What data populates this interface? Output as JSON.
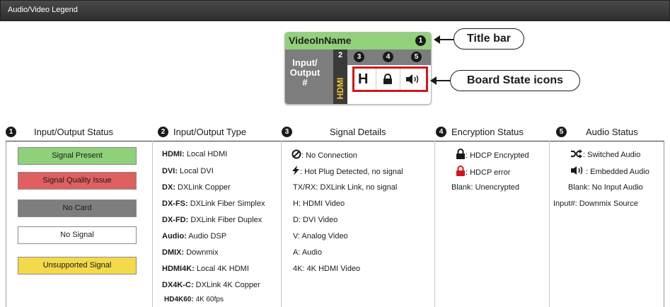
{
  "window": {
    "title": "Audio/Video Legend"
  },
  "board": {
    "name": "VideoInName",
    "io_label_1": "Input/",
    "io_label_2": "Output",
    "io_label_3": "#",
    "port_number": "2",
    "type_label": "HDMI",
    "state_letter": "H",
    "markers": [
      "1",
      "3",
      "4",
      "5"
    ]
  },
  "callouts": {
    "title_bar": "Title bar",
    "board_state": "Board State icons"
  },
  "columns": [
    {
      "num": "1",
      "title": "Input/Output Status"
    },
    {
      "num": "2",
      "title": "Input/Output Type"
    },
    {
      "num": "3",
      "title": "Signal Details"
    },
    {
      "num": "4",
      "title": "Encryption Status"
    },
    {
      "num": "5",
      "title": "Audio Status"
    }
  ],
  "io_status": [
    {
      "label": "Signal Present",
      "color": "#8fd17a"
    },
    {
      "label": "Signal Quality Issue",
      "color": "#e06060"
    },
    {
      "label": "No Card",
      "color": "#7e7e7e"
    },
    {
      "label": "No Signal",
      "color": "#ffffff"
    },
    {
      "label": "Unsupported Signal",
      "color": "#f4d94a"
    }
  ],
  "io_type": [
    {
      "key": "HDMI:",
      "text": " Local HDMI"
    },
    {
      "key": "DVI:",
      "text": " Local DVI"
    },
    {
      "key": "DX:",
      "text": " DXLink Copper"
    },
    {
      "key": "DX-FS:",
      "text": " DXLink Fiber Simplex"
    },
    {
      "key": "DX-FD:",
      "text": " DXLink Fiber Duplex"
    },
    {
      "key": "Audio:",
      "text": " Audio DSP"
    },
    {
      "key": "DMIX:",
      "text": " Downmix"
    },
    {
      "key": "HDMI4K:",
      "text": " Local 4K HDMI"
    },
    {
      "key": "DX4K-C:",
      "text": " DXLink 4K Copper"
    },
    {
      "key": "HD4K60:",
      "text": " 4K 60fps"
    }
  ],
  "signal_details": [
    {
      "icon": "no-connection-icon",
      "text": ": No Connection"
    },
    {
      "icon": "hot-plug-icon",
      "text": ": Hot Plug Detected, no signal"
    },
    {
      "key": "",
      "text": "TX/RX: DXLink Link, no signal"
    },
    {
      "key": "",
      "text": "H: HDMI Video"
    },
    {
      "key": "",
      "text": "D: DVI Video"
    },
    {
      "key": "",
      "text": "V: Analog Video"
    },
    {
      "key": "",
      "text": "A: Audio"
    },
    {
      "key": "",
      "text": "4K: 4K HDMI Video"
    }
  ],
  "encryption": [
    {
      "icon": "lock-black-icon",
      "text": ": HDCP Encrypted"
    },
    {
      "icon": "lock-red-icon",
      "text": ": HDCP error"
    },
    {
      "text": "Blank: Unencrypted"
    }
  ],
  "audio": [
    {
      "icon": "shuffle-icon",
      "text": ": Switched Audio"
    },
    {
      "icon": "speaker-icon",
      "text": ": Embedded Audio"
    },
    {
      "text": "Blank: No Input Audio"
    },
    {
      "text": "Input#: Downmix Source"
    }
  ],
  "colors": {
    "title_green": "#93d07a",
    "accent_red": "#d4141a",
    "board_gray": "#7d7d7d"
  }
}
